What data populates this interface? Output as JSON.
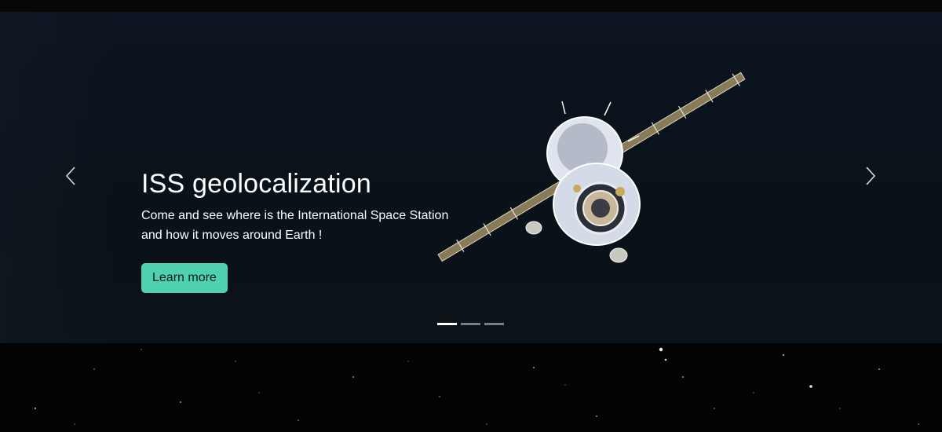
{
  "carousel": {
    "slides": [
      {
        "title": "ISS geolocalization",
        "text": "Come and see where is the International Space Station and how it moves around Earth !",
        "button_label": "Learn more"
      }
    ],
    "active_index": 0,
    "indicator_count": 3,
    "prev_icon": "chevron-left-icon",
    "next_icon": "chevron-right-icon"
  },
  "colors": {
    "accent": "#4fd1b0",
    "background": "#030304",
    "slide_background": "#0b1420"
  }
}
